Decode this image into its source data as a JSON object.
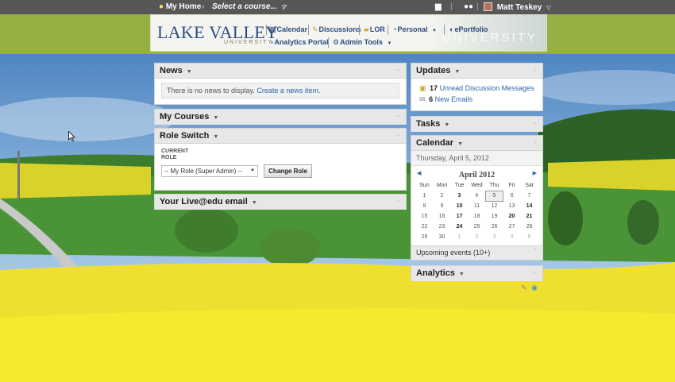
{
  "topbar": {
    "home_label": "My Home",
    "course_selector": "Select a course...",
    "user_name": "Matt Teskey"
  },
  "banner": {
    "logo_main": "LAKE VALLEY",
    "logo_sub": "UNIVERSITY",
    "watermark": "UNIVERSITY",
    "nav": {
      "calendar": "Calendar",
      "discussions": "Discussions",
      "lor": "LOR",
      "personal": "Personal",
      "eportfolio": "ePortfolio",
      "analytics_portal": "Analytics Portal",
      "admin_tools": "Admin Tools"
    }
  },
  "news": {
    "title": "News",
    "empty_text": "There is no news to display.",
    "create_link": "Create a news item."
  },
  "my_courses": {
    "title": "My Courses"
  },
  "role_switch": {
    "title": "Role Switch",
    "label_line1": "CURRENT",
    "label_line2": "ROLE",
    "selected_role": "-- My Role (Super Admin) --",
    "button": "Change Role"
  },
  "live_email": {
    "title": "Your Live@edu email"
  },
  "updates": {
    "title": "Updates",
    "items": [
      {
        "count": "17",
        "label": "Unread Discussion Messages"
      },
      {
        "count": "6",
        "label": "New Emails"
      }
    ]
  },
  "tasks": {
    "title": "Tasks"
  },
  "calendar": {
    "title": "Calendar",
    "date_line": "Thursday, April 5, 2012",
    "month": "April 2012",
    "weekdays": [
      "Sun",
      "Mon",
      "Tue",
      "Wed",
      "Thu",
      "Fri",
      "Sat"
    ],
    "weeks": [
      [
        "1",
        "2",
        "3",
        "4",
        "5",
        "6",
        "7"
      ],
      [
        "8",
        "9",
        "10",
        "11",
        "12",
        "13",
        "14"
      ],
      [
        "15",
        "16",
        "17",
        "18",
        "19",
        "20",
        "21"
      ],
      [
        "22",
        "23",
        "24",
        "25",
        "26",
        "27",
        "28"
      ],
      [
        "29",
        "30",
        "1",
        "2",
        "3",
        "4",
        "5"
      ]
    ],
    "upcoming": "Upcoming events (10+)"
  },
  "analytics": {
    "title": "Analytics"
  },
  "colors": {
    "topbar": "#575757",
    "band": "#96b043",
    "link": "#2d67a8",
    "logo": "#2c4c80",
    "field": "#f2e334"
  }
}
